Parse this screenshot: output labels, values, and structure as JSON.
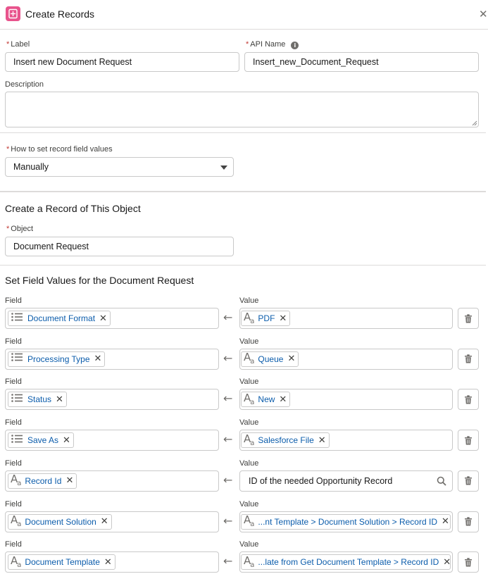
{
  "header": {
    "title": "Create Records"
  },
  "label": {
    "caption": "Label",
    "required": "*",
    "value": "Insert new Document Request"
  },
  "api_name": {
    "caption": "API Name",
    "required": "*",
    "value": "Insert_new_Document_Request",
    "info_icon": "info-icon"
  },
  "description": {
    "caption": "Description",
    "value": ""
  },
  "how_to_set": {
    "caption": "How to set record field values",
    "required": "*",
    "value": "Manually"
  },
  "object_section": {
    "title": "Create a Record of This Object",
    "object_caption": "Object",
    "required": "*",
    "object_value": "Document Request"
  },
  "field_values": {
    "title": "Set Field Values for the Document Request",
    "field_caption": "Field",
    "value_caption": "Value",
    "rows": [
      {
        "field": "Document Format",
        "field_icon": "picklist-icon",
        "value": "PDF",
        "value_type": "pill"
      },
      {
        "field": "Processing Type",
        "field_icon": "picklist-icon",
        "value": "Queue",
        "value_type": "pill"
      },
      {
        "field": "Status",
        "field_icon": "picklist-icon",
        "value": "New",
        "value_type": "pill"
      },
      {
        "field": "Save As",
        "field_icon": "picklist-icon",
        "value": "Salesforce File",
        "value_type": "pill"
      },
      {
        "field": "Record Id",
        "field_icon": "text-icon",
        "value": "ID of the needed Opportunity Record",
        "value_type": "text"
      },
      {
        "field": "Document Solution",
        "field_icon": "text-icon",
        "value": "...nt Template > Document Solution > Record ID",
        "value_type": "resource"
      },
      {
        "field": "Document Template",
        "field_icon": "text-icon",
        "value": "...late from Get Document Template > Record ID",
        "value_type": "resource"
      }
    ]
  },
  "colors": {
    "accent_icon": "#e8538c",
    "link_text": "#0b5cab",
    "required_mark": "#c23934"
  }
}
